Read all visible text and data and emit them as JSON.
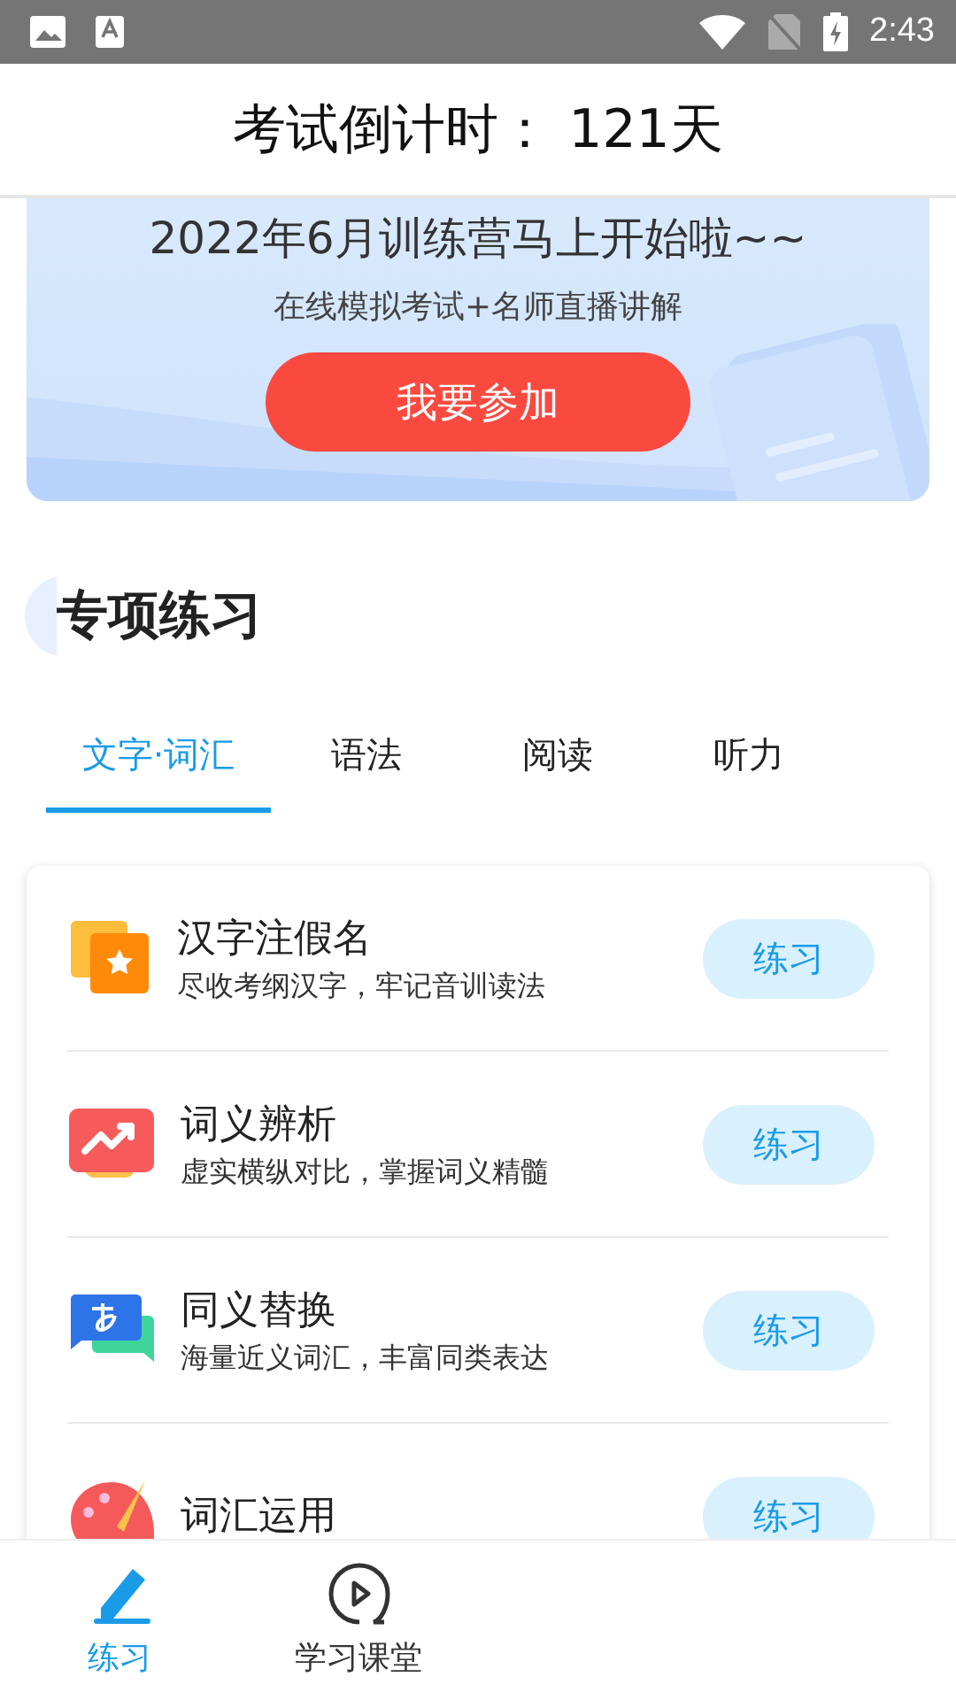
{
  "status_bar": {
    "time": "2:43"
  },
  "header": {
    "title": "考试倒计时： 121天"
  },
  "banner": {
    "headline": "2022年6月训练营马上开始啦~~",
    "subline": "在线模拟考试+名师直播讲解",
    "button": "我要参加"
  },
  "section": {
    "title": "专项练习"
  },
  "tabs": [
    {
      "label": "文字·词汇",
      "selected": true
    },
    {
      "label": "语法",
      "selected": false
    },
    {
      "label": "阅读",
      "selected": false
    },
    {
      "label": "听力",
      "selected": false
    }
  ],
  "exercises": [
    {
      "kind": "kana",
      "title": "汉字注假名",
      "subtitle": "尽收考纲汉字，牢记音训读法",
      "button": "练习"
    },
    {
      "kind": "trend",
      "title": "词义辨析",
      "subtitle": "虚实横纵对比，掌握词义精髓",
      "button": "练习"
    },
    {
      "kind": "chat",
      "title": "同义替换",
      "subtitle": "海量近义词汇，丰富同类表达",
      "button": "练习"
    },
    {
      "kind": "palette",
      "title": "词汇运用",
      "button": "练习"
    }
  ],
  "bottom_nav": [
    {
      "kind": "pencil",
      "label": "练习",
      "selected": true
    },
    {
      "kind": "play",
      "label": "学习课堂",
      "selected": false
    }
  ]
}
